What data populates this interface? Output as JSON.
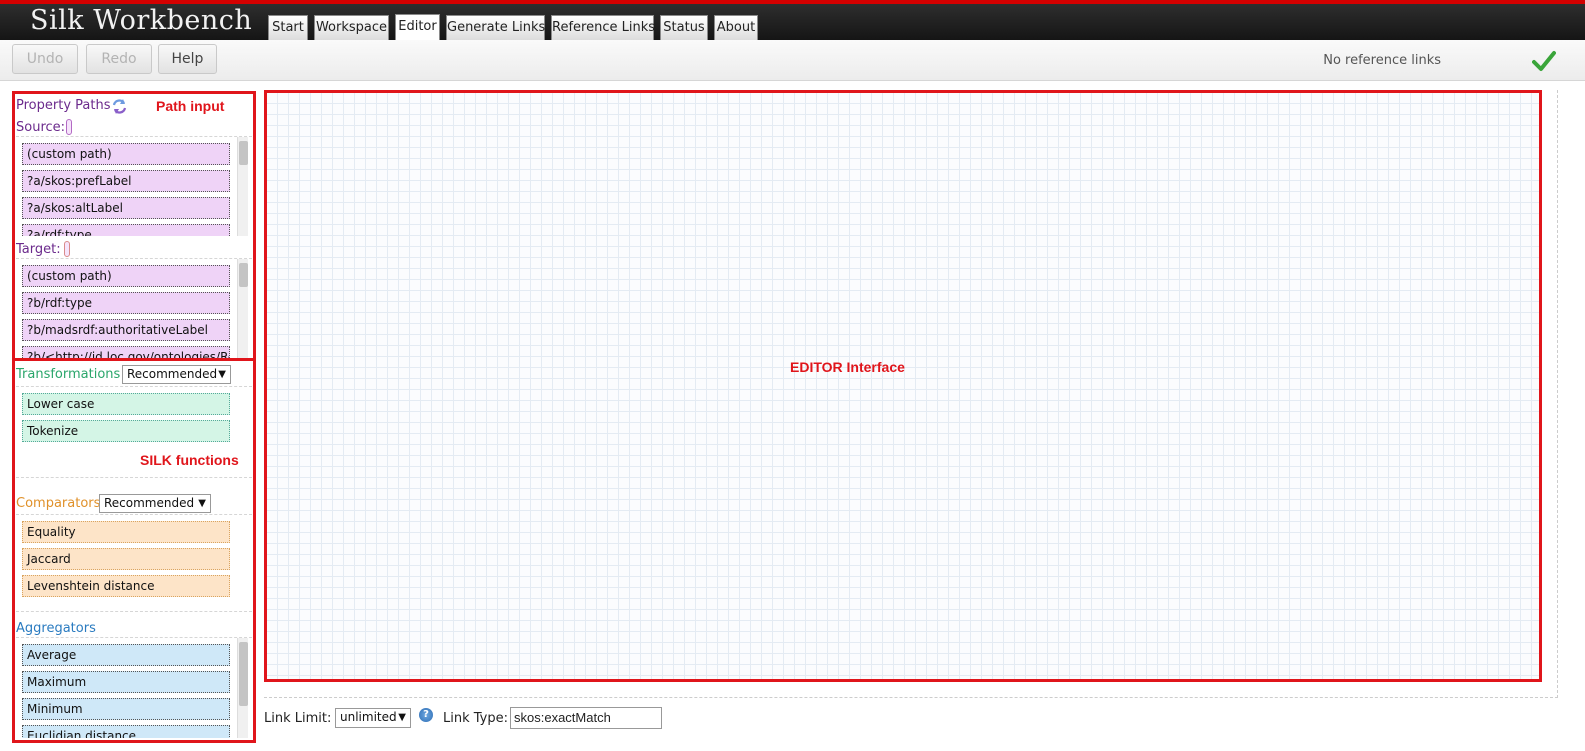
{
  "header": {
    "app_title": "Silk Workbench",
    "tabs": [
      {
        "label": "Start"
      },
      {
        "label": "Workspace"
      },
      {
        "label": "Editor"
      },
      {
        "label": "Generate Links"
      },
      {
        "label": "Reference Links"
      },
      {
        "label": "Status"
      },
      {
        "label": "About"
      }
    ],
    "active_tab": "Editor"
  },
  "toolbar": {
    "undo_label": "Undo",
    "redo_label": "Redo",
    "help_label": "Help",
    "status_text": "No reference links",
    "status_icon": "check-icon"
  },
  "sidebar": {
    "property_paths": {
      "title": "Property Paths",
      "refresh_icon": "refresh-icon",
      "source_label": "Source:",
      "source_items": [
        "(custom path)",
        "?a/skos:prefLabel",
        "?a/skos:altLabel",
        "?a/rdf:type"
      ],
      "target_label": "Target:",
      "target_items": [
        "(custom path)",
        "?b/rdf:type",
        "?b/madsrdf:authoritativeLabel",
        "?b/<http://id.loc.gov/ontologies/Re"
      ]
    },
    "transformations": {
      "title": "Transformations",
      "filter": "Recommended",
      "items": [
        "Lower case",
        "Tokenize"
      ]
    },
    "comparators": {
      "title": "Comparators",
      "filter": "Recommended",
      "items": [
        "Equality",
        "Jaccard",
        "Levenshtein distance"
      ]
    },
    "aggregators": {
      "title": "Aggregators",
      "items": [
        "Average",
        "Maximum",
        "Minimum",
        "Euclidian distance"
      ]
    }
  },
  "annotations": {
    "path_input": "Path input",
    "silk_functions": "SILK functions",
    "editor_interface": "EDITOR Interface"
  },
  "bottom": {
    "link_limit_label": "Link Limit:",
    "link_limit_value": "unlimited",
    "link_type_label": "Link Type:",
    "link_type_value": "skos:exactMatch"
  },
  "colors": {
    "accent_red": "#e0151b",
    "property_paths": "#6b2a8c",
    "transformations": "#2aa66b",
    "comparators": "#e0912a",
    "aggregators": "#2a7bc0"
  }
}
